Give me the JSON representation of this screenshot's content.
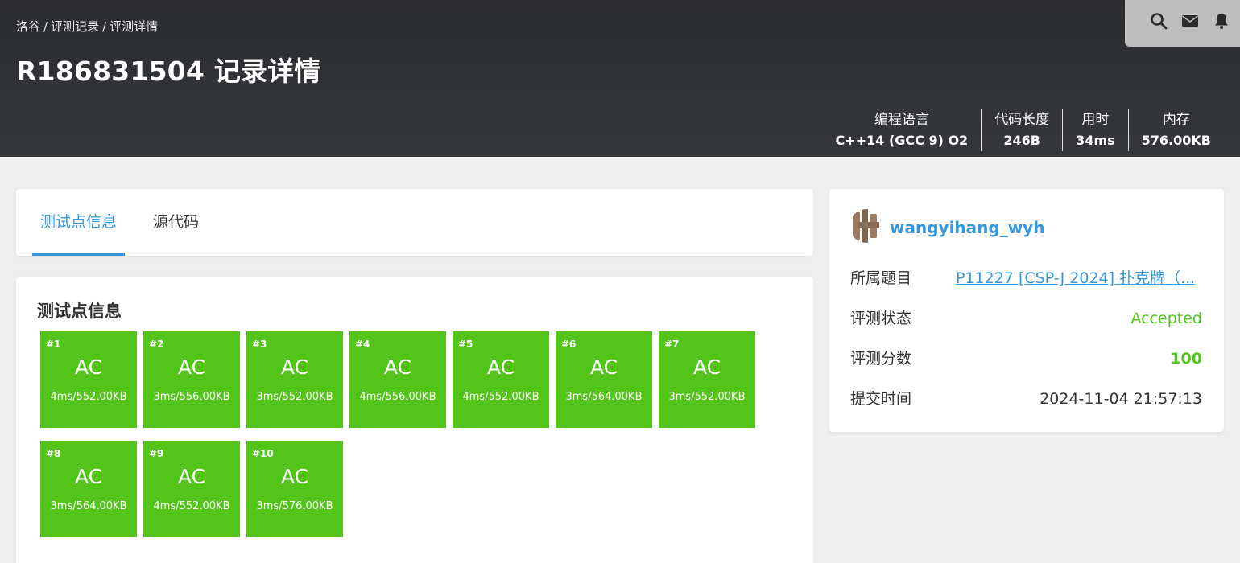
{
  "breadcrumb": {
    "items": [
      "洛谷",
      "评测记录",
      "评测详情"
    ],
    "separator": "/"
  },
  "page": {
    "title": "R186831504 记录详情"
  },
  "topbar": {
    "icons": [
      "search-icon",
      "mail-icon",
      "bell-icon"
    ]
  },
  "stats": [
    {
      "key": "编程语言",
      "value": "C++14 (GCC 9) O2"
    },
    {
      "key": "代码长度",
      "value": "246B"
    },
    {
      "key": "用时",
      "value": "34ms"
    },
    {
      "key": "内存",
      "value": "576.00KB"
    }
  ],
  "tabs": [
    {
      "label": "测试点信息",
      "active": true
    },
    {
      "label": "源代码",
      "active": false
    }
  ],
  "cases_section": {
    "title": "测试点信息",
    "cases": [
      {
        "num": "#1",
        "result": "AC",
        "info": "4ms/552.00KB"
      },
      {
        "num": "#2",
        "result": "AC",
        "info": "3ms/556.00KB"
      },
      {
        "num": "#3",
        "result": "AC",
        "info": "3ms/552.00KB"
      },
      {
        "num": "#4",
        "result": "AC",
        "info": "4ms/556.00KB"
      },
      {
        "num": "#5",
        "result": "AC",
        "info": "4ms/552.00KB"
      },
      {
        "num": "#6",
        "result": "AC",
        "info": "3ms/564.00KB"
      },
      {
        "num": "#7",
        "result": "AC",
        "info": "3ms/552.00KB"
      },
      {
        "num": "#8",
        "result": "AC",
        "info": "3ms/564.00KB"
      },
      {
        "num": "#9",
        "result": "AC",
        "info": "4ms/552.00KB"
      },
      {
        "num": "#10",
        "result": "AC",
        "info": "3ms/576.00KB"
      }
    ]
  },
  "side": {
    "username": "wangyihang_wyh",
    "problem_label": "所属题目",
    "problem_value": "P11227 [CSP-J 2024] 扑克牌（...",
    "status_label": "评测状态",
    "status_value": "Accepted",
    "score_label": "评测分数",
    "score_value": "100",
    "time_label": "提交时间",
    "time_value": "2024-11-04 21:57:13"
  },
  "colors": {
    "accent": "#3498db",
    "ac_green": "#52c41a",
    "header_bg": "#2b2c2f",
    "page_bg": "#efefef"
  }
}
